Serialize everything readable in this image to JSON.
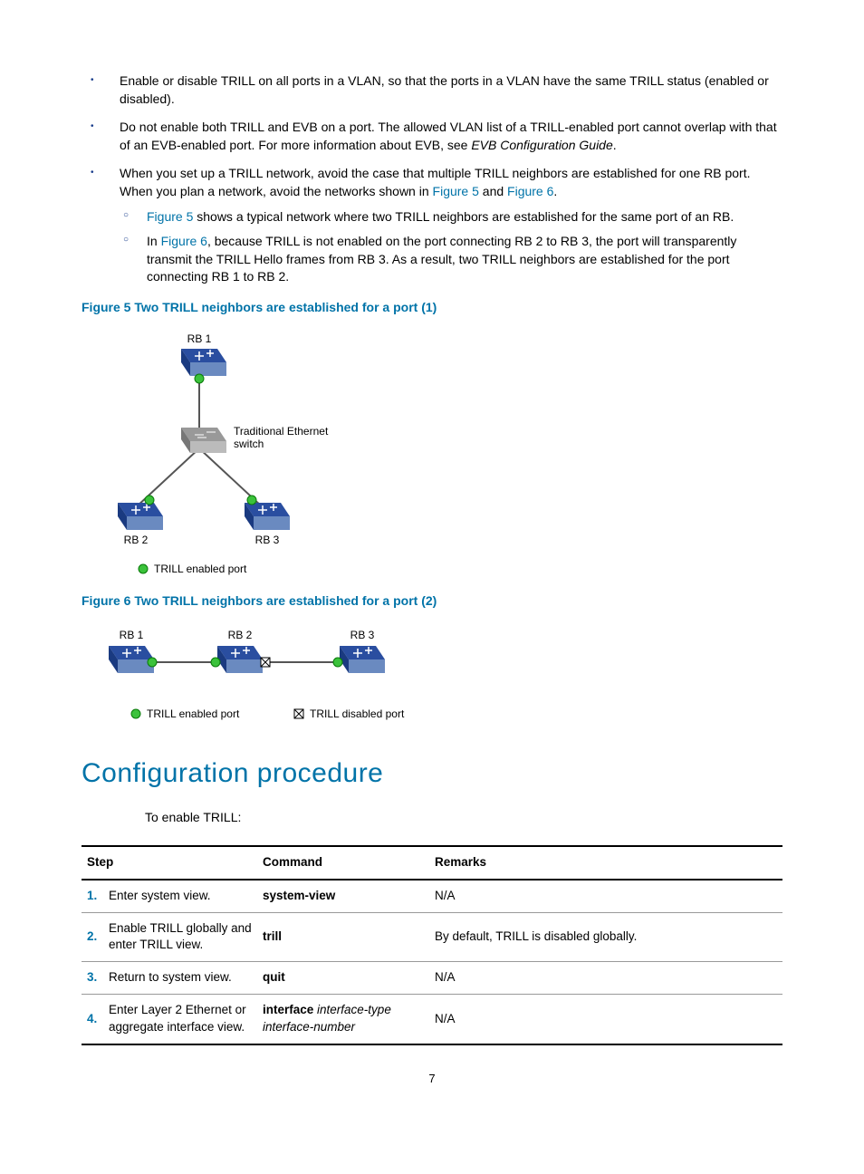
{
  "bullets": [
    {
      "text": "Enable or disable TRILL on all ports in a VLAN, so that the ports in a VLAN have the same TRILL status (enabled or disabled)."
    },
    {
      "text_pre": "Do not enable both TRILL and EVB on a port. The allowed VLAN list of a TRILL-enabled port cannot overlap with that of an EVB-enabled port. For more information about EVB, see ",
      "text_italic": "EVB Configuration Guide",
      "text_post": "."
    },
    {
      "text_pre": "When you set up a TRILL network, avoid the case that multiple TRILL neighbors are established for one RB port. When you plan a network, avoid the networks shown in ",
      "link1": "Figure 5",
      "mid": " and ",
      "link2": "Figure 6",
      "post": ".",
      "subs": [
        {
          "link": "Figure 5",
          "text": " shows a typical network where two TRILL neighbors are established for the same port of an RB."
        },
        {
          "pre": "In ",
          "link": "Figure 6",
          "text": ", because TRILL is not enabled on the port connecting RB 2 to RB 3, the port will transparently transmit the TRILL Hello frames from RB 3. As a result, two TRILL neighbors are established for the port connecting RB 1 to RB 2."
        }
      ]
    }
  ],
  "figure5": {
    "caption": "Figure 5 Two TRILL neighbors are established for a port (1)",
    "labels": {
      "rb1": "RB 1",
      "rb2": "RB 2",
      "rb3": "RB 3",
      "switch": "Traditional Ethernet switch",
      "legend": "TRILL enabled port"
    }
  },
  "figure6": {
    "caption": "Figure 6 Two TRILL neighbors are established for a port (2)",
    "labels": {
      "rb1": "RB 1",
      "rb2": "RB 2",
      "rb3": "RB 3",
      "legend1": "TRILL enabled port",
      "legend2": "TRILL disabled port"
    }
  },
  "section_heading": "Configuration procedure",
  "intro_text": "To enable TRILL:",
  "table": {
    "headers": {
      "step": "Step",
      "command": "Command",
      "remarks": "Remarks"
    },
    "rows": [
      {
        "num": "1.",
        "step": "Enter system view.",
        "cmd": "system-view",
        "remarks": "N/A"
      },
      {
        "num": "2.",
        "step": "Enable TRILL globally and enter TRILL view.",
        "cmd": "trill",
        "remarks": "By default, TRILL is disabled globally."
      },
      {
        "num": "3.",
        "step": "Return to system view.",
        "cmd": "quit",
        "remarks": "N/A"
      },
      {
        "num": "4.",
        "step": "Enter Layer 2 Ethernet or aggregate interface view.",
        "cmd_bold": "interface",
        "cmd_italic": " interface-type interface-number",
        "remarks": "N/A"
      }
    ]
  },
  "page_number": "7"
}
